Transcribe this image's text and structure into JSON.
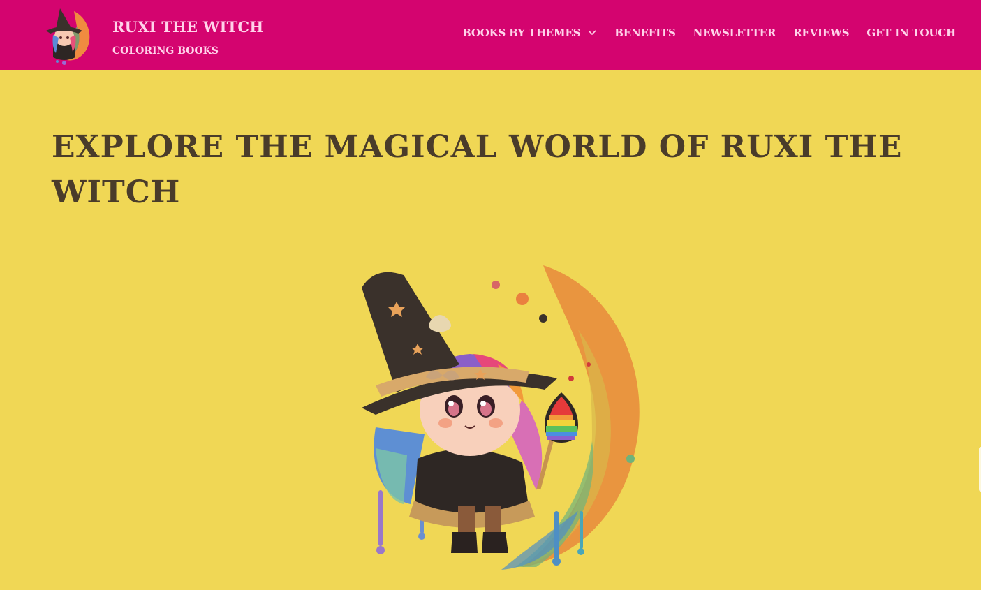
{
  "header": {
    "site_title": "RUXI THE WITCH",
    "tagline": "COLORING BOOKS",
    "logo_icon": "witch-logo-icon",
    "background_color": "#d4046f",
    "text_color": "#ffd3ea"
  },
  "nav": {
    "items": [
      {
        "label": "BOOKS BY THEMES",
        "has_dropdown": true
      },
      {
        "label": "BENEFITS"
      },
      {
        "label": "NEWSLETTER"
      },
      {
        "label": "REVIEWS"
      },
      {
        "label": "GET IN TOUCH"
      }
    ],
    "dropdown_icon": "chevron-down-icon"
  },
  "hero": {
    "heading": "EXPLORE THE MAGICAL WORLD OF RUXI THE WITCH",
    "image": "witch-illustration-icon",
    "heading_color": "#4a3c2a",
    "background_color": "#f0d755"
  }
}
